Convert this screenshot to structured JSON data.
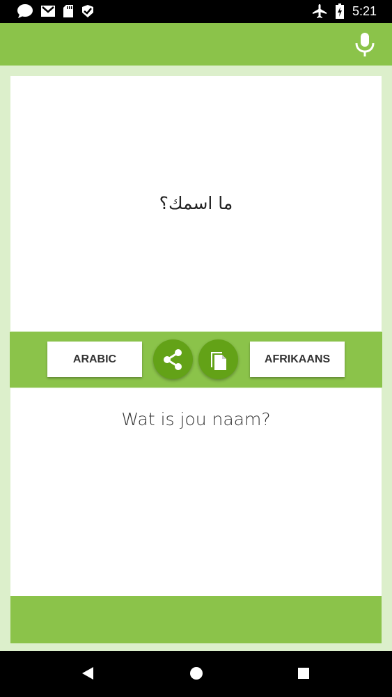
{
  "status_bar": {
    "time": "5:21",
    "left_icons": [
      "chat-bubble-icon",
      "gmail-icon",
      "sd-card-icon",
      "check-badge-icon"
    ],
    "right_icons": [
      "airplane-icon",
      "battery-icon"
    ]
  },
  "app_bar": {
    "action_icon": "microphone-icon"
  },
  "translation": {
    "source_text": "ما اسمك؟",
    "target_text": "Wat is jou naam?"
  },
  "controls": {
    "source_language": "ARABIC",
    "target_language": "AFRIKAANS",
    "share_icon": "share-icon",
    "copy_icon": "copy-icon"
  },
  "nav_bar": {
    "icons": [
      "back-icon",
      "home-icon",
      "recents-icon"
    ]
  },
  "colors": {
    "primary": "#8bc34a",
    "button_dark": "#63a217",
    "background": "#dcefcb"
  }
}
